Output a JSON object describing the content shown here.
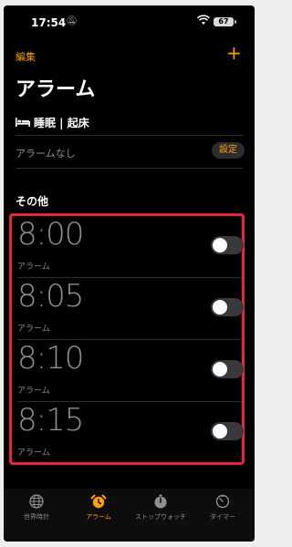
{
  "status": {
    "time": "17:54",
    "battery": "67"
  },
  "header": {
    "edit_label": "編集",
    "add_label": "+",
    "title": "アラーム"
  },
  "sleep": {
    "label": "睡眠 | 起床",
    "no_alarm": "アラームなし",
    "set_label": "設定"
  },
  "section": {
    "others": "その他"
  },
  "alarms": [
    {
      "time": "8:00",
      "label": "アラーム"
    },
    {
      "time": "8:05",
      "label": "アラーム"
    },
    {
      "time": "8:10",
      "label": "アラーム"
    },
    {
      "time": "8:15",
      "label": "アラーム"
    }
  ],
  "tabs": [
    {
      "label": "世界時計",
      "icon": "globe-icon"
    },
    {
      "label": "アラーム",
      "icon": "alarm-clock-icon"
    },
    {
      "label": "ストップウォッチ",
      "icon": "stopwatch-icon"
    },
    {
      "label": "タイマー",
      "icon": "timer-icon"
    }
  ],
  "colors": {
    "accent": "#ff9f0a",
    "highlight": "#e8253e",
    "background": "#000000"
  }
}
